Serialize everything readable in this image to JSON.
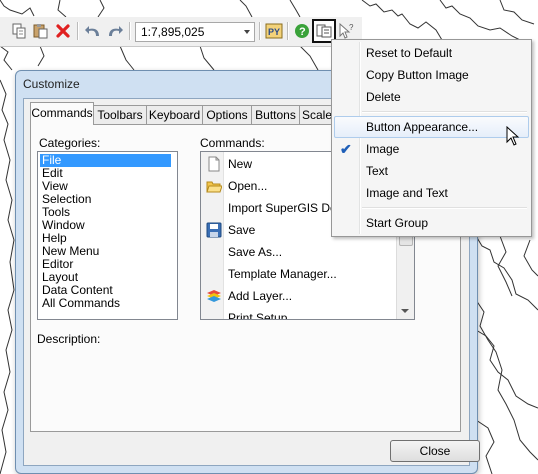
{
  "toolbar": {
    "scale_value": "1:7,895,025",
    "buttons": [
      "copy-icon",
      "paste-icon",
      "delete-icon",
      "undo-icon",
      "redo-icon",
      "scale-combo",
      "python-icon",
      "help-icon",
      "button-appearance-icon",
      "whats-this-icon"
    ]
  },
  "dialog": {
    "title": "Customize",
    "tabs": [
      "Commands",
      "Toolbars",
      "Keyboard",
      "Options",
      "Buttons",
      "Scale"
    ],
    "categories_label": "Categories:",
    "commands_label": "Commands:",
    "description_label": "Description:",
    "categories": [
      "File",
      "Edit",
      "View",
      "Selection",
      "Tools",
      "Window",
      "Help",
      "New Menu",
      "Editor",
      "Layout",
      "Data Content",
      "All Commands"
    ],
    "selected_category": "File",
    "commands": [
      {
        "label": "New",
        "icon": "new-document-icon"
      },
      {
        "label": "Open...",
        "icon": "open-folder-icon"
      },
      {
        "label": "Import SuperGIS Desktop",
        "icon": ""
      },
      {
        "label": "Save",
        "icon": "save-icon"
      },
      {
        "label": "Save As...",
        "icon": ""
      },
      {
        "label": "Template Manager...",
        "icon": ""
      },
      {
        "label": "Add Layer...",
        "icon": "add-layer-icon"
      },
      {
        "label": "Print Setup...",
        "icon": ""
      }
    ],
    "close_label": "Close"
  },
  "context_menu": {
    "items": [
      "Reset to Default",
      "Copy Button Image",
      "Delete",
      "Button Appearance...",
      "Image",
      "Text",
      "Image and Text",
      "Start Group"
    ],
    "highlighted": "Button Appearance...",
    "checked": "Image"
  },
  "colors": {
    "selection": "#3399ff",
    "dialog_frame": "#cfe0f2",
    "check": "#1f5fb8"
  }
}
